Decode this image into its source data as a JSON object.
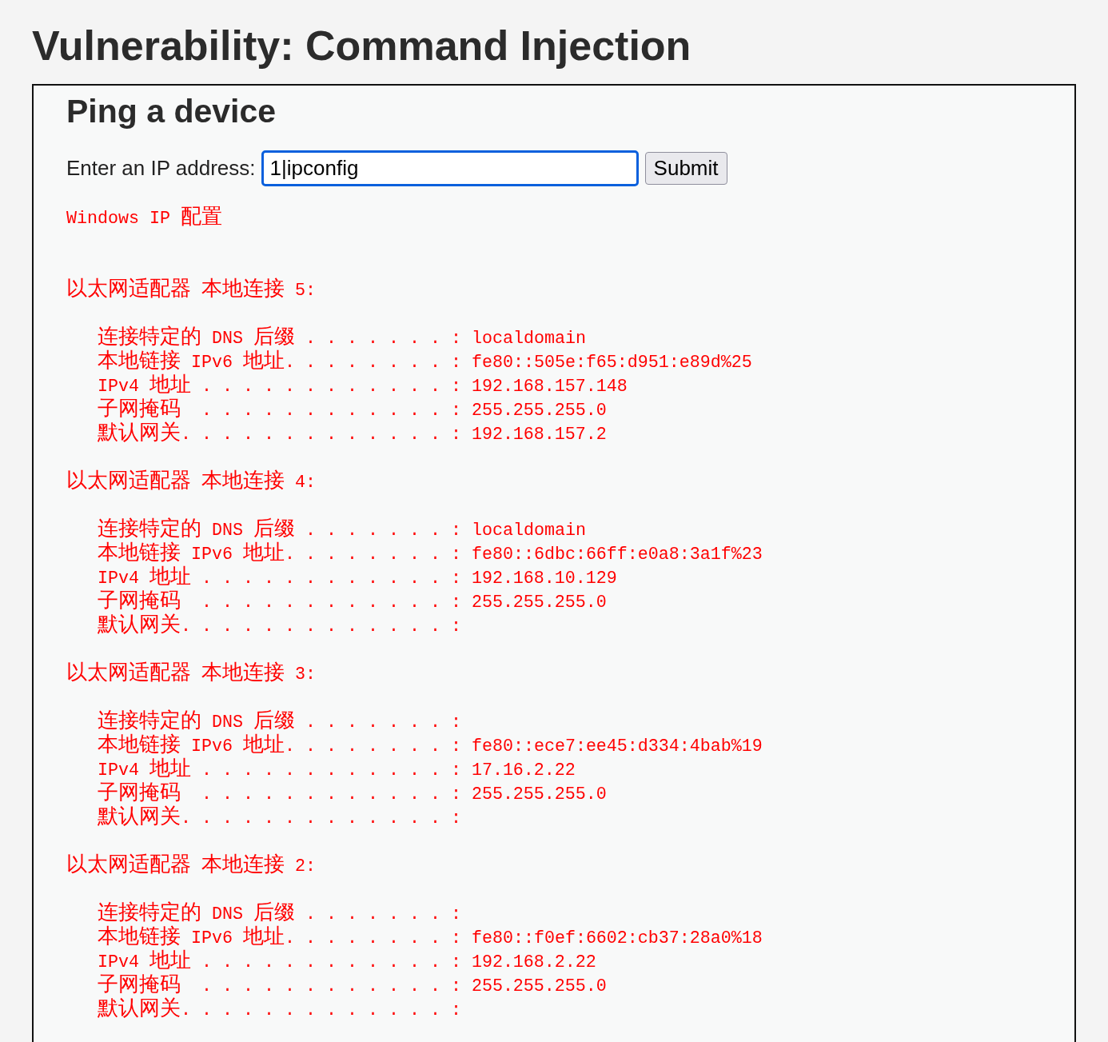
{
  "page": {
    "title": "Vulnerability: Command Injection"
  },
  "panel": {
    "heading": "Ping a device",
    "form": {
      "label": "Enter an IP address:",
      "input": {
        "value": "1|ipconfig",
        "focused": true
      },
      "submit": "Submit"
    },
    "output": {
      "heading": "Windows IP 配置",
      "adapters": [
        {
          "title": "以太网适配器 本地连接 5:",
          "entries": [
            {
              "label": "连接特定的 DNS 后缀 . . . . . . . :",
              "value": "localdomain"
            },
            {
              "label": "本地链接 IPv6 地址. . . . . . . . :",
              "value": "fe80::505e:f65:d951:e89d%25"
            },
            {
              "label": "IPv4 地址 . . . . . . . . . . . . :",
              "value": "192.168.157.148"
            },
            {
              "label": "子网掩码  . . . . . . . . . . . . :",
              "value": "255.255.255.0"
            },
            {
              "label": "默认网关. . . . . . . . . . . . . :",
              "value": "192.168.157.2"
            }
          ]
        },
        {
          "title": "以太网适配器 本地连接 4:",
          "entries": [
            {
              "label": "连接特定的 DNS 后缀 . . . . . . . :",
              "value": "localdomain"
            },
            {
              "label": "本地链接 IPv6 地址. . . . . . . . :",
              "value": "fe80::6dbc:66ff:e0a8:3a1f%23"
            },
            {
              "label": "IPv4 地址 . . . . . . . . . . . . :",
              "value": "192.168.10.129"
            },
            {
              "label": "子网掩码  . . . . . . . . . . . . :",
              "value": "255.255.255.0"
            },
            {
              "label": "默认网关. . . . . . . . . . . . . :"
            }
          ]
        },
        {
          "title": "以太网适配器 本地连接 3:",
          "entries": [
            {
              "label": "连接特定的 DNS 后缀 . . . . . . . :"
            },
            {
              "label": "本地链接 IPv6 地址. . . . . . . . :",
              "value": "fe80::ece7:ee45:d334:4bab%19"
            },
            {
              "label": "IPv4 地址 . . . . . . . . . . . . :",
              "value": "17.16.2.22"
            },
            {
              "label": "子网掩码  . . . . . . . . . . . . :",
              "value": "255.255.255.0"
            },
            {
              "label": "默认网关. . . . . . . . . . . . . :"
            }
          ]
        },
        {
          "title": "以太网适配器 本地连接 2:",
          "entries": [
            {
              "label": "连接特定的 DNS 后缀 . . . . . . . :"
            },
            {
              "label": "本地链接 IPv6 地址. . . . . . . . :",
              "value": "fe80::f0ef:6602:cb37:28a0%18"
            },
            {
              "label": "IPv4 地址 . . . . . . . . . . . . :",
              "value": "192.168.2.22"
            },
            {
              "label": "子网掩码  . . . . . . . . . . . . :",
              "value": "255.255.255.0"
            },
            {
              "label": "默认网关. . . . . . . . . . . . . :"
            }
          ]
        }
      ]
    }
  }
}
